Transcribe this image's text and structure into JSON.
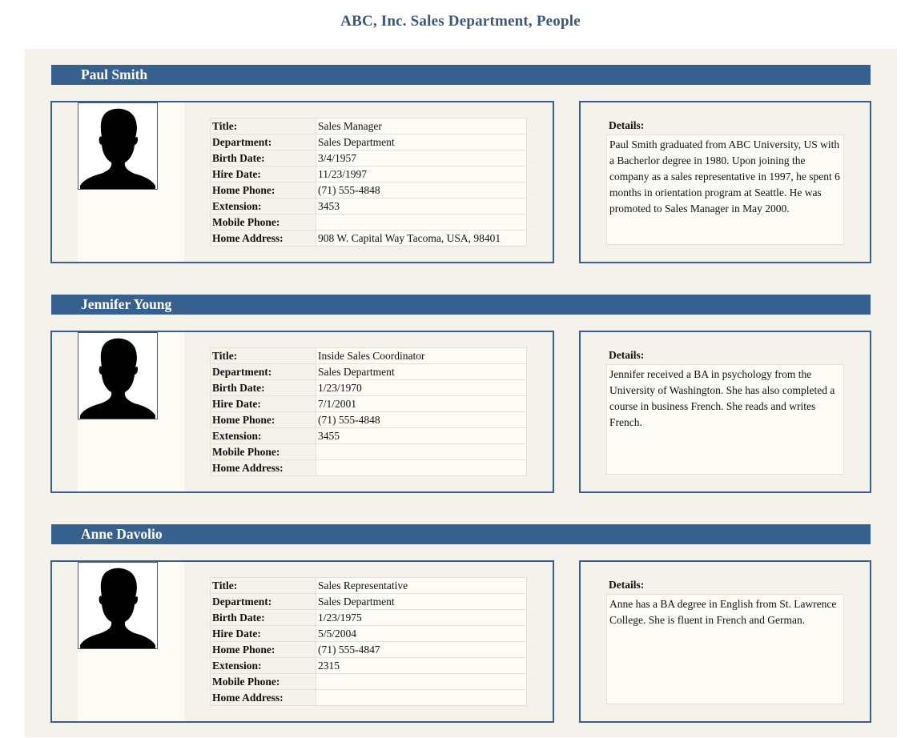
{
  "page": {
    "title": "ABC, Inc. Sales Department, People"
  },
  "labels": {
    "title": "Title:",
    "department": "Department:",
    "birth_date": "Birth Date:",
    "hire_date": "Hire Date:",
    "home_phone": "Home Phone:",
    "extension": "Extension:",
    "mobile_phone": "Mobile Phone:",
    "home_address": "Home Address:",
    "details": "Details:"
  },
  "people": [
    {
      "name": "Paul Smith",
      "title": "Sales Manager",
      "department": "Sales Department",
      "birth_date": "3/4/1957",
      "hire_date": "11/23/1997",
      "home_phone": "(71) 555-4848",
      "extension": "3453",
      "mobile_phone": "",
      "home_address": "908 W. Capital Way Tacoma, USA, 98401",
      "details": "Paul Smith graduated from ABC University, US with a Bacherlor degree in 1980. Upon joining the company as a sales representative in 1997, he spent 6 months in orientation program at Seattle. He was promoted to Sales Manager in May 2000."
    },
    {
      "name": "Jennifer Young",
      "title": "Inside Sales Coordinator",
      "department": "Sales Department",
      "birth_date": "1/23/1970",
      "hire_date": "7/1/2001",
      "home_phone": "(71) 555-4848",
      "extension": "3455",
      "mobile_phone": "",
      "home_address": "",
      "details": "Jennifer received a BA in psychology from the University of Washington.  She has also completed a course in business French.  She reads and writes French."
    },
    {
      "name": "Anne Davolio",
      "title": "Sales Representative",
      "department": "Sales Department",
      "birth_date": "1/23/1975",
      "hire_date": "5/5/2004",
      "home_phone": "(71) 555-4847",
      "extension": "2315",
      "mobile_phone": "",
      "home_address": "",
      "details": "Anne has a BA degree in English from St. Lawrence College.  She is fluent in French and German."
    }
  ]
}
